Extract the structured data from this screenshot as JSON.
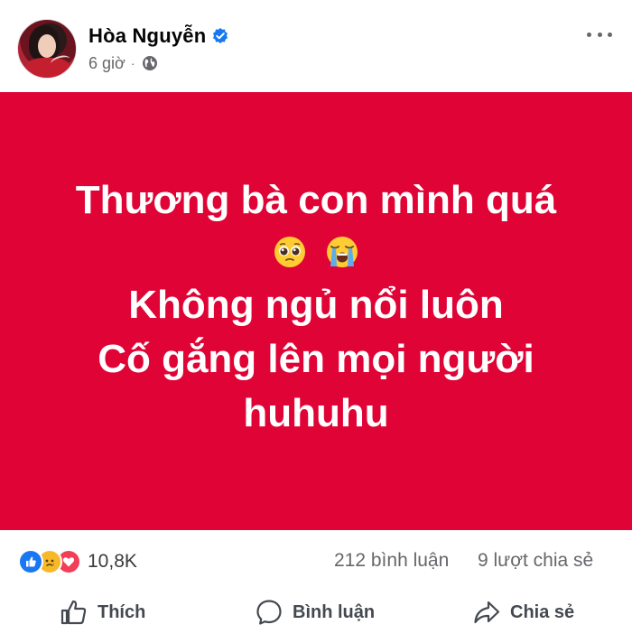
{
  "post": {
    "author_name": "Hòa Nguyễn",
    "time": "6 giờ",
    "meta_separator": "·",
    "background_color": "#df0336",
    "text_lines": [
      "Thương bà con mình quá",
      "Không ngủ nổi luôn",
      "Cố gắng lên mọi người",
      "huhuhu"
    ],
    "emojis": [
      "pleading-face",
      "loudly-crying-face"
    ]
  },
  "stats": {
    "reaction_count": "10,8K",
    "reactions": [
      "like",
      "sad",
      "love"
    ],
    "comments": "212 bình luận",
    "shares": "9 lượt chia sẻ"
  },
  "actions": {
    "like_label": "Thích",
    "comment_label": "Bình luận",
    "share_label": "Chia sẻ"
  },
  "icons": {
    "verified": "verified-badge-icon",
    "privacy": "globe-icon",
    "more": "more-options-icon"
  },
  "colors": {
    "accent": "#1877f2",
    "text_secondary": "#65676b"
  }
}
